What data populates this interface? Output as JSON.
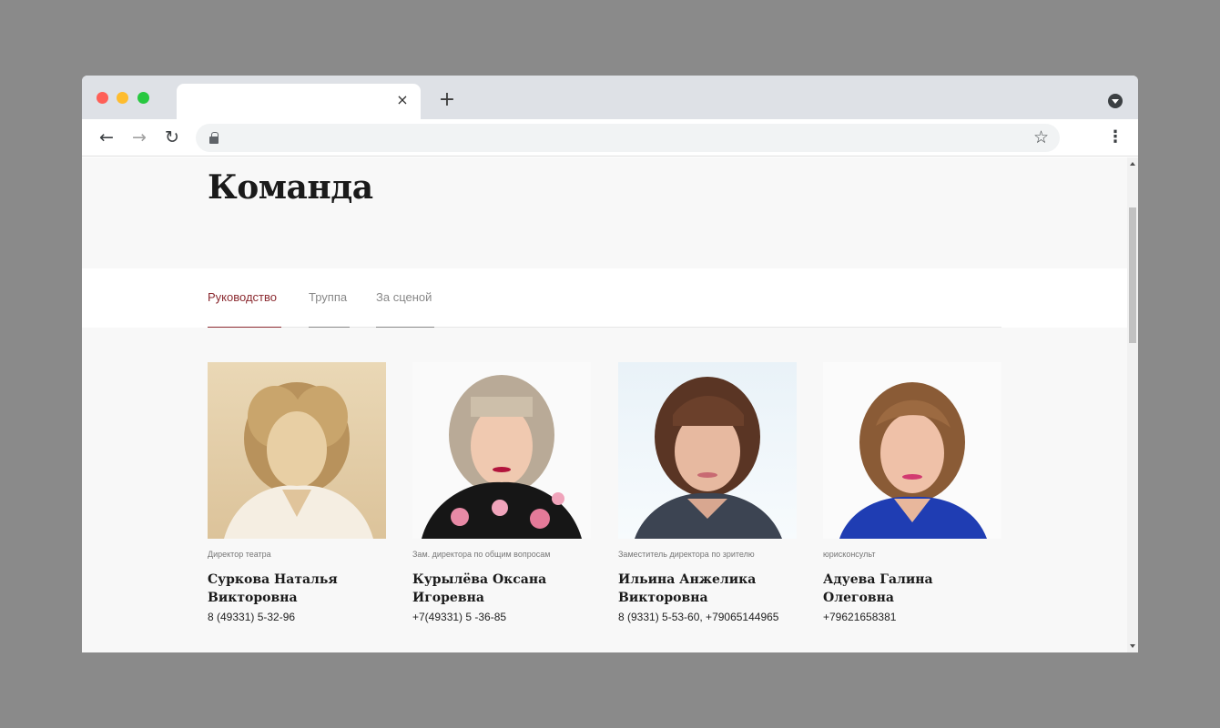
{
  "browser": {
    "tab_title": "",
    "close_icon": "×",
    "new_tab_icon": "+",
    "back_icon": "←",
    "forward_icon": "→",
    "reload_icon": "↻",
    "star_icon": "☆",
    "menu_icon": "⋮",
    "url": ""
  },
  "page": {
    "title": "Команда",
    "tabs": [
      {
        "label": "Руководство",
        "active": true
      },
      {
        "label": "Труппа",
        "active": false
      },
      {
        "label": "За сценой",
        "active": false
      }
    ],
    "accent_color": "#8b2a30",
    "team": [
      {
        "role": "Директор театра",
        "name": "Суркова Наталья Викторовна",
        "phone": "8 (49331) 5-32-96",
        "photo": "sepia-portrait-blonde"
      },
      {
        "role": "Зам. директора по общим вопросам",
        "name": "Курылёва Оксана Игоревна",
        "phone": "+7(49331) 5 -36-85",
        "photo": "portrait-blonde-bob-floral"
      },
      {
        "role": "Заместитель директора по зрителю",
        "name": "Ильина Анжелика Викторовна",
        "phone": "8 (9331) 5-53-60, +79065144965",
        "photo": "portrait-brown-bob"
      },
      {
        "role": "юрисконсульт",
        "name": "Адуева Галина Олеговна",
        "phone": "+79621658381",
        "photo": "portrait-auburn-blue-jacket"
      }
    ]
  }
}
